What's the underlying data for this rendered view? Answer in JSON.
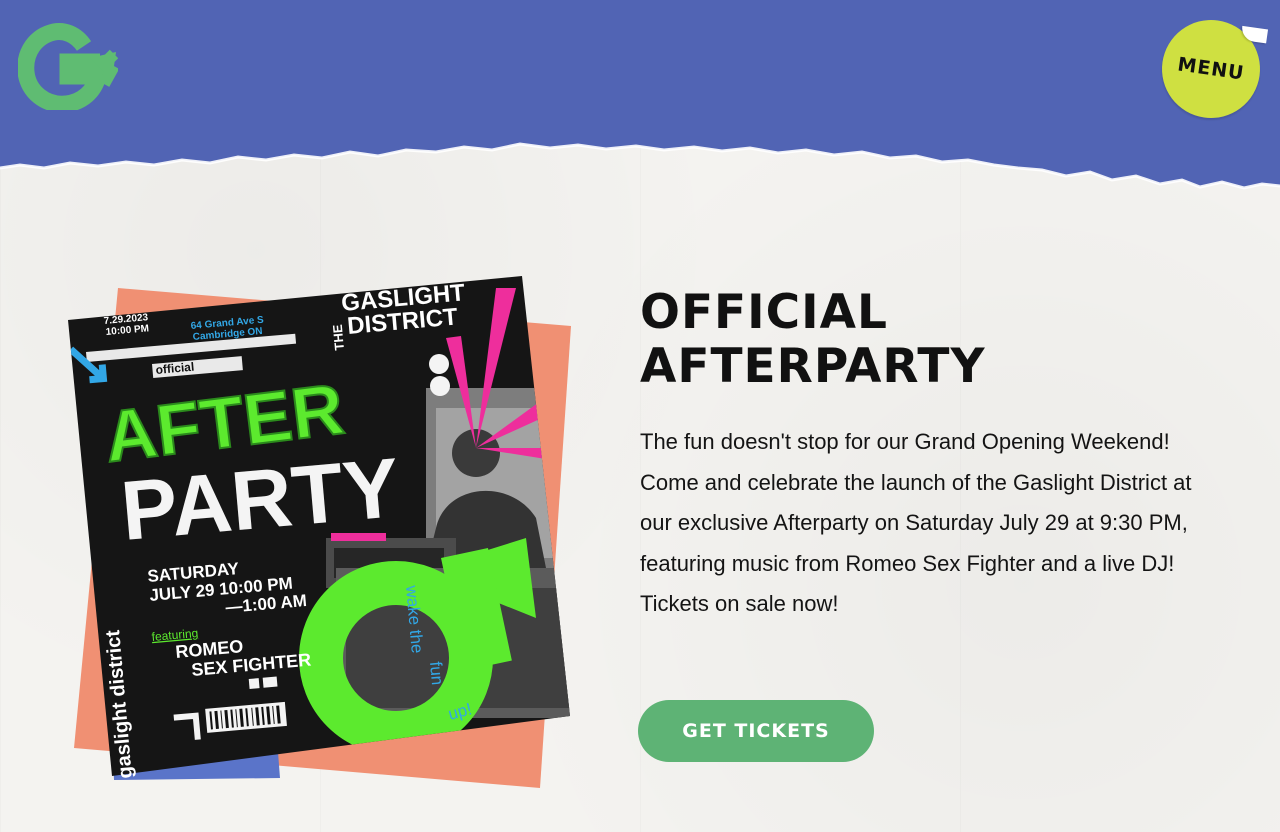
{
  "header": {
    "logo_letter": "G",
    "menu_label": "MENU"
  },
  "colors": {
    "header_blue": "#5164b4",
    "menu_yellow": "#cfe041",
    "button_green": "#5eb375",
    "logo_green": "#5fbc72",
    "poster_green": "#5cea2e",
    "poster_pink": "#ee2e9c",
    "poster_salmon": "#f09073",
    "poster_cyan": "#32a7e6"
  },
  "poster": {
    "date": "7.29.2023",
    "time": "10:00 PM",
    "address_line1": "64 Grand Ave S",
    "address_line2": "Cambridge ON",
    "brand_the": "THE",
    "brand_gaslight": "GASLIGHT",
    "brand_district": "DISTRICT",
    "official": "official",
    "after": "AFTER",
    "party": "PARTY",
    "day": "SATURDAY",
    "date_time": "JULY 29  10:00 PM",
    "end_time": "—1:00 AM",
    "featuring": "featuring",
    "act_line1": "ROMEO",
    "act_line2": "SEX FIGHTER",
    "side_text": "gaslight district",
    "tagline_1": "wake the",
    "tagline_2": "fun",
    "tagline_3": "up!"
  },
  "main": {
    "title_line1": "OFFICIAL",
    "title_line2": "AFTERPARTY",
    "description": "The fun doesn't stop for our Grand Opening Weekend! Come and celebrate the launch of the Gaslight District at our exclusive Afterparty on Saturday July 29 at 9:30 PM, featuring music from Romeo Sex Fighter and a live DJ! Tickets on sale now!",
    "cta_label": "GET TICKETS"
  }
}
